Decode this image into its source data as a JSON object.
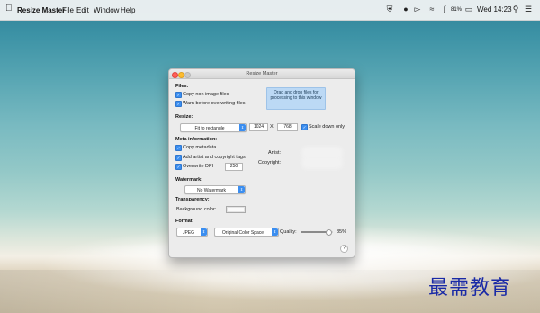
{
  "menubar": {
    "apple_icon": "apple-logo",
    "app_name": "Resize Master",
    "menus": [
      "File",
      "Edit",
      "Window",
      "Help"
    ],
    "battery": "81%",
    "clock": "Wed 14:23"
  },
  "window": {
    "title": "Resize Master",
    "files": {
      "header": "Files:",
      "copy_non_image": "Copy non image files",
      "warn_overwrite": "Warn before overwriting files",
      "drop_text": "Drag and drop files for processing to this window"
    },
    "resize": {
      "header": "Resize:",
      "mode": "Fit to rectangle",
      "width": "1024",
      "times": "X",
      "height": "768",
      "scale_down_only": "Scale down only"
    },
    "meta": {
      "header": "Meta information:",
      "copy_metadata": "Copy metadata",
      "add_tags": "Add artist and copyright tags",
      "overwrite_dpi": "Overwrite DPI",
      "dpi": "250",
      "artist_label": "Artist:",
      "copyright_label": "Copyright:"
    },
    "watermark": {
      "header": "Watermark:",
      "selection": "No Watermark"
    },
    "transparency": {
      "header": "Transparency:",
      "bg_label": "Background color:",
      "bg_color": "#fafafa"
    },
    "format": {
      "header": "Format:",
      "type": "JPEG",
      "color_space": "Original Color Space",
      "quality_label": "Quality:",
      "quality": "85%",
      "quality_value": 0.85
    },
    "help_label": "?"
  },
  "colors": {
    "accent": "#3b8ef0",
    "drop_zone": "#bcd9f5",
    "watermark_text": "#1a2aa6"
  },
  "site_watermark": "最需教育"
}
